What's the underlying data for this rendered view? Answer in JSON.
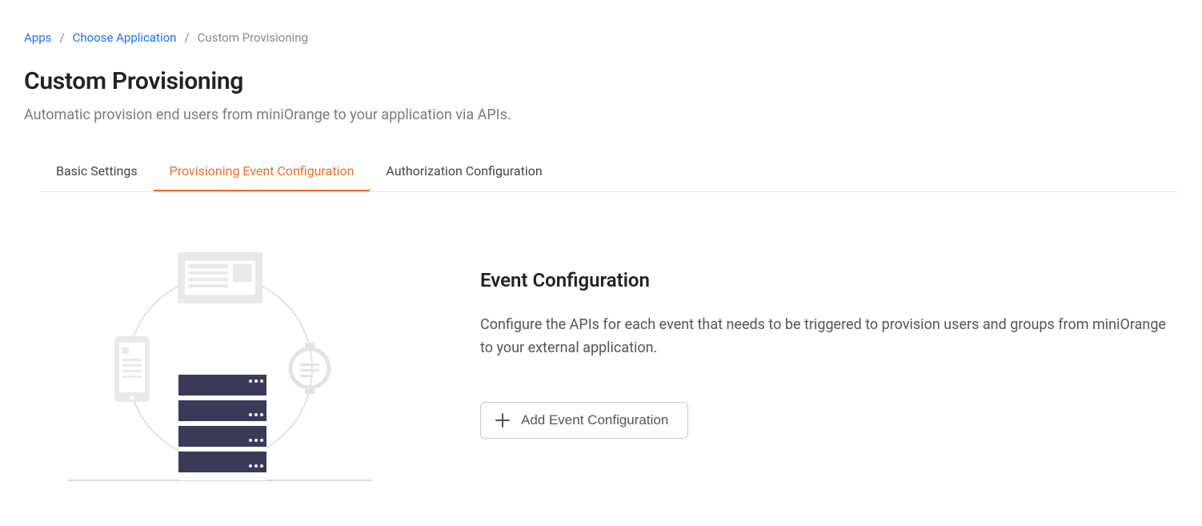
{
  "breadcrumb": {
    "apps": "Apps",
    "choose": "Choose Application",
    "current": "Custom Provisioning"
  },
  "page": {
    "title": "Custom Provisioning",
    "subtitle": "Automatic provision end users from miniOrange to your application via APIs."
  },
  "tabs": [
    {
      "label": "Basic Settings"
    },
    {
      "label": "Provisioning Event Configuration"
    },
    {
      "label": "Authorization Configuration"
    }
  ],
  "section": {
    "title": "Event Configuration",
    "text": "Configure the APIs for each event that needs to be triggered to provision users and groups from miniOrange to your external application.",
    "add_label": "Add Event Configuration"
  }
}
